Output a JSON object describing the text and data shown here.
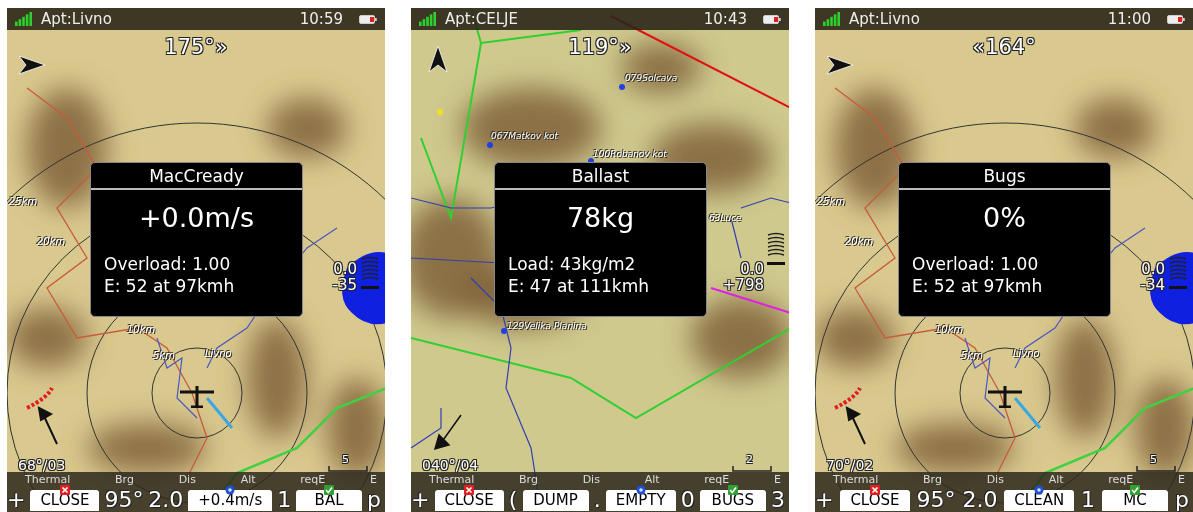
{
  "panels": [
    {
      "status": {
        "waypoint": "Apt:Livno",
        "time": "10:59"
      },
      "heading": "175°»",
      "range_labels": [
        "25km",
        "20km",
        "10km",
        "5km",
        "Livno"
      ],
      "dialog": {
        "title": "MacCready",
        "value": "+0.0m/s",
        "lines": [
          "Overload: 1.00",
          "E: 52 at 97kmh"
        ]
      },
      "vario": [
        "0.0",
        "-35"
      ],
      "wind": "68°/03",
      "scale": "5",
      "bottom_labels": [
        "Thermal",
        "Brg",
        "Dis",
        "Alt",
        "reqE",
        "E"
      ],
      "bottom_row": [
        {
          "kind": "value",
          "text": "+"
        },
        {
          "kind": "button",
          "text": "CLOSE",
          "badge": {
            "kind": "cross"
          }
        },
        {
          "kind": "value",
          "text": "95°"
        },
        {
          "kind": "value",
          "text": "2.0"
        },
        {
          "kind": "button",
          "text": "+0.4m/s",
          "badge": {
            "kind": "dot"
          }
        },
        {
          "kind": "value",
          "text": "1"
        },
        {
          "kind": "button",
          "text": "BAL",
          "badge": {
            "kind": "check"
          }
        },
        {
          "kind": "value",
          "text": "p"
        }
      ]
    },
    {
      "status": {
        "waypoint": "Apt:CELJE",
        "time": "10:43"
      },
      "heading": "119°»",
      "waypoints": [
        "079Solcava",
        "067Matkov kot",
        "100Robanov kot",
        "63Luce",
        "129Velika Planina"
      ],
      "dialog": {
        "title": "Ballast",
        "value": "78kg",
        "lines": [
          "Load: 43kg/m2",
          "E: 47 at 111kmh"
        ]
      },
      "vario": [
        "0.0",
        "+798"
      ],
      "wind": "040°/04",
      "scale": "2",
      "bottom_labels": [
        "Thermal",
        "Brg",
        "Dis",
        "Alt",
        "reqE",
        "E"
      ],
      "bottom_row": [
        {
          "kind": "value",
          "text": "+"
        },
        {
          "kind": "button",
          "text": "CLOSE",
          "badge": {
            "kind": "cross"
          }
        },
        {
          "kind": "value",
          "text": "("
        },
        {
          "kind": "button",
          "text": "DUMP"
        },
        {
          "kind": "value",
          "text": "."
        },
        {
          "kind": "button",
          "text": "EMPTY",
          "badge": {
            "kind": "dot"
          }
        },
        {
          "kind": "value",
          "text": "0"
        },
        {
          "kind": "button",
          "text": "BUGS",
          "badge": {
            "kind": "check"
          }
        },
        {
          "kind": "value",
          "text": "3"
        }
      ]
    },
    {
      "status": {
        "waypoint": "Apt:Livno",
        "time": "11:00"
      },
      "heading": "«164°",
      "range_labels": [
        "25km",
        "20km",
        "10km",
        "5km",
        "Livno"
      ],
      "dialog": {
        "title": "Bugs",
        "value": "0%",
        "lines": [
          "Overload: 1.00",
          "E: 52 at 97kmh"
        ]
      },
      "vario": [
        "0.0",
        "-34"
      ],
      "wind": "70°/02",
      "scale": "5",
      "bottom_labels": [
        "Thermal",
        "Brg",
        "Dis",
        "Alt",
        "reqE",
        "E"
      ],
      "bottom_row": [
        {
          "kind": "value",
          "text": "+"
        },
        {
          "kind": "button",
          "text": "CLOSE",
          "badge": {
            "kind": "cross"
          }
        },
        {
          "kind": "value",
          "text": "95°"
        },
        {
          "kind": "value",
          "text": "2.0"
        },
        {
          "kind": "button",
          "text": "CLEAN",
          "badge": {
            "kind": "dot"
          }
        },
        {
          "kind": "value",
          "text": "1"
        },
        {
          "kind": "button",
          "text": "MC",
          "badge": {
            "kind": "check"
          }
        },
        {
          "kind": "value",
          "text": "p"
        }
      ]
    }
  ]
}
